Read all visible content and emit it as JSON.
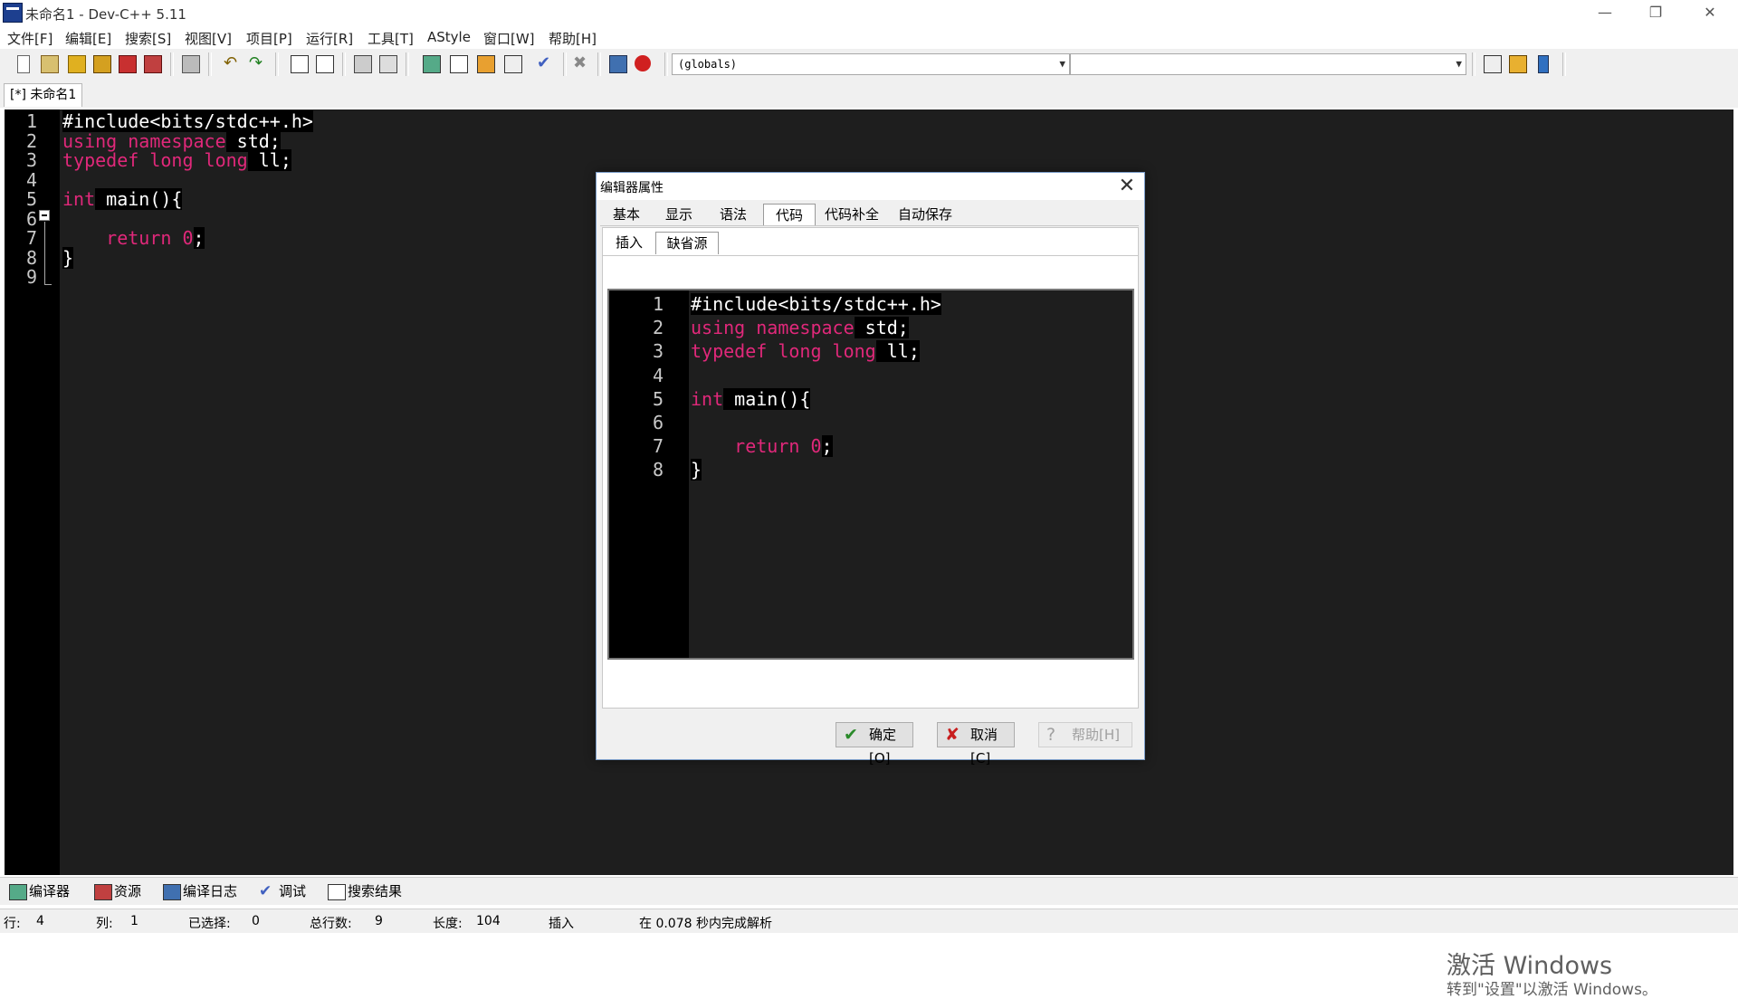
{
  "window": {
    "title": "未命名1 - Dev-C++ 5.11",
    "minimize": "—",
    "restore": "❐",
    "close": "✕"
  },
  "menu": [
    "文件[F]",
    "编辑[E]",
    "搜索[S]",
    "视图[V]",
    "项目[P]",
    "运行[R]",
    "工具[T]",
    "AStyle",
    "窗口[W]",
    "帮助[H]"
  ],
  "toolbar": {
    "class_combo": "(globals)",
    "member_combo": ""
  },
  "tabs": {
    "active": "[*] 未命名1"
  },
  "editor": {
    "lines": [
      {
        "n": "1",
        "segments": [
          {
            "t": "#include<bits/stdc++.h>",
            "c": "hl"
          }
        ]
      },
      {
        "n": "2",
        "segments": [
          {
            "t": "using namespace",
            "c": "kw"
          },
          {
            "t": " std;",
            "c": "hl"
          }
        ]
      },
      {
        "n": "3",
        "segments": [
          {
            "t": "typedef long long",
            "c": "kw"
          },
          {
            "t": " ll;",
            "c": "hl"
          }
        ]
      },
      {
        "n": "4",
        "segments": []
      },
      {
        "n": "5",
        "segments": [
          {
            "t": "int",
            "c": "kw"
          },
          {
            "t": " main(){",
            "c": "hl"
          }
        ]
      },
      {
        "n": "6",
        "segments": []
      },
      {
        "n": "7",
        "segments": [
          {
            "t": "    return ",
            "c": "kw"
          },
          {
            "t": "0",
            "c": "num"
          },
          {
            "t": ";",
            "c": "hl"
          }
        ]
      },
      {
        "n": "8",
        "segments": [
          {
            "t": "}",
            "c": "hl"
          }
        ]
      },
      {
        "n": "9",
        "segments": []
      }
    ]
  },
  "watermark": {
    "line1": "激活 Windows",
    "line2": "转到\"设置\"以激活 Windows。"
  },
  "bottom_tabs": [
    "编译器",
    "资源",
    "编译日志",
    "调试",
    "搜索结果"
  ],
  "status": {
    "row_label": "行:",
    "row": "4",
    "col_label": "列:",
    "col": "1",
    "sel_label": "已选择:",
    "sel": "0",
    "total_label": "总行数:",
    "total": "9",
    "len_label": "长度:",
    "len": "104",
    "mode": "插入",
    "parse": "在 0.078 秒内完成解析"
  },
  "dialog": {
    "title": "编辑器属性",
    "close": "✕",
    "tabs": [
      "基本",
      "显示",
      "语法",
      "代码",
      "代码补全",
      "自动保存"
    ],
    "active_tab": "代码",
    "subtabs": [
      "插入",
      "缺省源"
    ],
    "active_subtab": "缺省源",
    "preview_lines": [
      {
        "n": "1",
        "segments": [
          {
            "t": "#include<bits/stdc++.h>",
            "c": "hl"
          }
        ]
      },
      {
        "n": "2",
        "segments": [
          {
            "t": "using namespace",
            "c": "kw"
          },
          {
            "t": " std;",
            "c": "hl"
          }
        ]
      },
      {
        "n": "3",
        "segments": [
          {
            "t": "typedef long long",
            "c": "kw"
          },
          {
            "t": " ll;",
            "c": "hl"
          }
        ]
      },
      {
        "n": "4",
        "segments": []
      },
      {
        "n": "5",
        "segments": [
          {
            "t": "int",
            "c": "kw"
          },
          {
            "t": " main(){",
            "c": "hl"
          }
        ]
      },
      {
        "n": "6",
        "segments": []
      },
      {
        "n": "7",
        "segments": [
          {
            "t": "    return ",
            "c": "kw"
          },
          {
            "t": "0",
            "c": "num"
          },
          {
            "t": ";",
            "c": "hl"
          }
        ]
      },
      {
        "n": "8",
        "segments": [
          {
            "t": "}",
            "c": "hl"
          }
        ]
      }
    ],
    "ok": "确定[O]",
    "cancel": "取消[C]",
    "help": "帮助[H]"
  },
  "colors": {
    "keyword": "#e0287a",
    "editor_bg": "#1e1e1e",
    "gutter_bg": "#000000"
  }
}
